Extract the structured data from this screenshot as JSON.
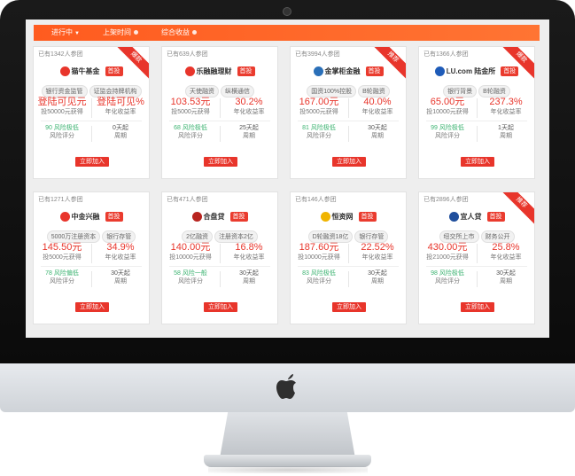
{
  "nav": {
    "tabs": [
      {
        "label": "进行中",
        "icon": "chevron-down-icon"
      },
      {
        "label": "上架时间",
        "icon": "dot-icon"
      },
      {
        "label": "综合收益",
        "icon": "dot-icon"
      }
    ]
  },
  "colors": {
    "accent": "#ff5b1f",
    "red": "#e8352b",
    "green": "#3cb371"
  },
  "cards": [
    {
      "participants": "已有1342人参团",
      "ribbon": "爆款",
      "platform": "猫牛基金",
      "first": "首投",
      "tags": [
        "银行资金监管",
        "证监会持牌机构"
      ],
      "value_left": "登陆可见元",
      "sub_left": "投50000元获得",
      "value_right": "登陆可见%",
      "sub_right": "年化收益率",
      "risk": "90 风险极低",
      "risk_label": "风险评分",
      "period": "0天起",
      "period_label": "周期",
      "button": "立即加入",
      "logo_color": "#e8352b"
    },
    {
      "participants": "已有639人参团",
      "ribbon": "",
      "platform": "乐融融理财",
      "first": "首投",
      "tags": [
        "天使融资",
        "纵横通信"
      ],
      "value_left": "103.53元",
      "sub_left": "投5000元获得",
      "value_right": "30.2%",
      "sub_right": "年化收益率",
      "risk": "68 风险极低",
      "risk_label": "风险评分",
      "period": "25天起",
      "period_label": "周期",
      "button": "立即加入",
      "logo_color": "#e8352b"
    },
    {
      "participants": "已有3994人参团",
      "ribbon": "推荐",
      "platform": "金掌柜金融",
      "first": "首投",
      "tags": [
        "国资100%控股",
        "B轮融资"
      ],
      "value_left": "167.00元",
      "sub_left": "投5000元获得",
      "value_right": "40.0%",
      "sub_right": "年化收益率",
      "risk": "81 风险极低",
      "risk_label": "风险评分",
      "period": "30天起",
      "period_label": "周期",
      "button": "立即加入",
      "logo_color": "#2a6fb8"
    },
    {
      "participants": "已有1366人参团",
      "ribbon": "爆款",
      "platform": "LU.com 陆金所",
      "first": "首投",
      "tags": [
        "银行背景",
        "B轮融资"
      ],
      "value_left": "65.00元",
      "sub_left": "投10000元获得",
      "value_right": "237.3%",
      "sub_right": "年化收益率",
      "risk": "99 风险极低",
      "risk_label": "风险评分",
      "period": "1天起",
      "period_label": "周期",
      "button": "立即加入",
      "logo_color": "#1e5bb8"
    },
    {
      "participants": "已有1271人参团",
      "ribbon": "",
      "platform": "中金兴融",
      "first": "首投",
      "tags": [
        "5000万注册资本",
        "银行存管"
      ],
      "value_left": "145.50元",
      "sub_left": "投5000元获得",
      "value_right": "34.9%",
      "sub_right": "年化收益率",
      "risk": "78 风险偏低",
      "risk_label": "风险评分",
      "period": "30天起",
      "period_label": "周期",
      "button": "立即加入",
      "logo_color": "#e8352b"
    },
    {
      "participants": "已有471人参团",
      "ribbon": "",
      "platform": "合盘贷",
      "first": "首投",
      "tags": [
        "2亿融资",
        "注册资本2亿"
      ],
      "value_left": "140.00元",
      "sub_left": "投10000元获得",
      "value_right": "16.8%",
      "sub_right": "年化收益率",
      "risk": "58 风险一般",
      "risk_label": "风险评分",
      "period": "30天起",
      "period_label": "周期",
      "button": "立即加入",
      "logo_color": "#b8241f"
    },
    {
      "participants": "已有146人参团",
      "ribbon": "",
      "platform": "恒资网",
      "first": "首投",
      "tags": [
        "D轮融资18亿",
        "银行存管"
      ],
      "value_left": "187.60元",
      "sub_left": "投10000元获得",
      "value_right": "22.52%",
      "sub_right": "年化收益率",
      "risk": "83 风险极低",
      "risk_label": "风险评分",
      "period": "30天起",
      "period_label": "周期",
      "button": "立即加入",
      "logo_color": "#f0b400"
    },
    {
      "participants": "已有2896人参团",
      "ribbon": "推荐",
      "platform": "宜人贷",
      "first": "首投",
      "tags": [
        "纽交所上市",
        "财务公开"
      ],
      "value_left": "430.00元",
      "sub_left": "投21000元获得",
      "value_right": "25.8%",
      "sub_right": "年化收益率",
      "risk": "98 风险极低",
      "risk_label": "风险评分",
      "period": "30天起",
      "period_label": "周期",
      "button": "立即加入",
      "logo_color": "#1f4e9c"
    }
  ]
}
